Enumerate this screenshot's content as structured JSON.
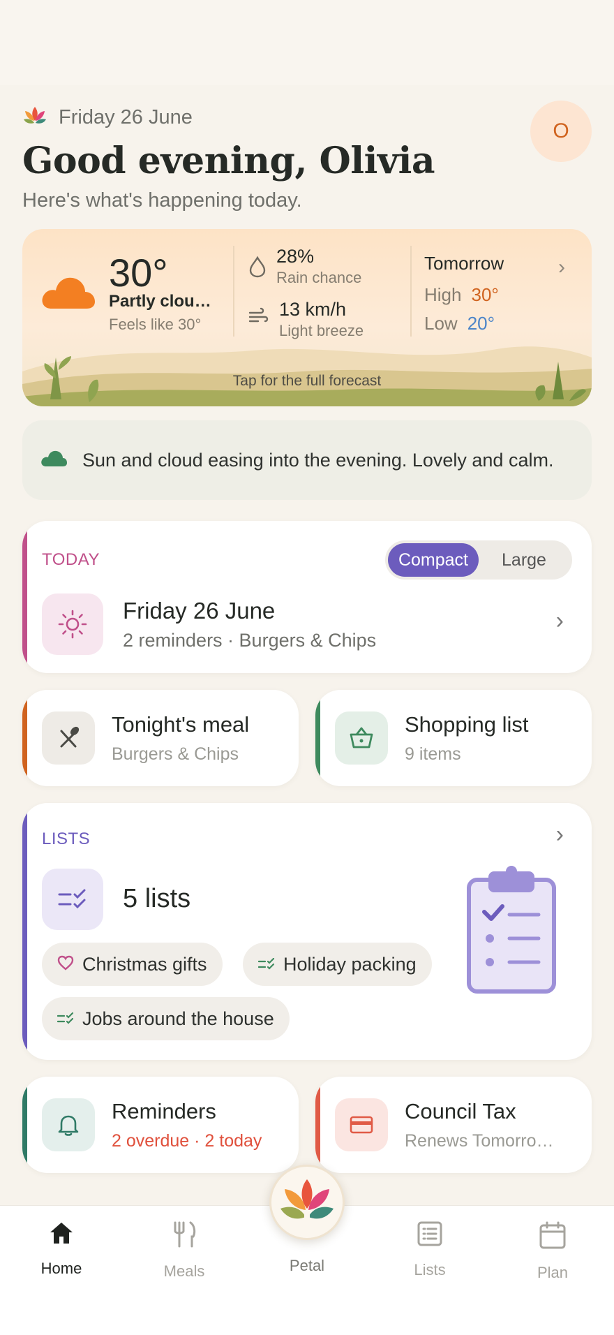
{
  "header": {
    "date": "Friday 26 June",
    "greeting": "Good evening, Olivia",
    "subtitle": "Here's what's happening today.",
    "avatar_initial": "O"
  },
  "weather": {
    "temp": "30°",
    "condition": "Partly clou…",
    "feels_like": "Feels like 30°",
    "rain_value": "28%",
    "rain_label": "Rain chance",
    "wind_value": "13 km/h",
    "wind_label": "Light breeze",
    "tomorrow_title": "Tomorrow",
    "high_label": "High",
    "high_value": "30°",
    "low_label": "Low",
    "low_value": "20°",
    "tap_hint": "Tap for the full forecast"
  },
  "note": {
    "text": "Sun and cloud easing into the evening. Lovely and calm."
  },
  "today": {
    "eyebrow": "TODAY",
    "view_compact": "Compact",
    "view_large": "Large",
    "title": "Friday 26 June",
    "subtitle": "2 reminders  ·  Burgers & Chips"
  },
  "meal": {
    "title": "Tonight's meal",
    "subtitle": "Burgers & Chips"
  },
  "shopping": {
    "title": "Shopping list",
    "subtitle": "9 items"
  },
  "lists": {
    "eyebrow": "LISTS",
    "count": "5 lists",
    "chips": [
      "Christmas gifts",
      "Holiday packing",
      "Jobs around the house"
    ]
  },
  "reminders": {
    "title": "Reminders",
    "subtitle": "2 overdue · 2 today"
  },
  "council": {
    "title": "Council Tax",
    "subtitle": "Renews Tomorro…"
  },
  "nav": {
    "home": "Home",
    "meals": "Meals",
    "petal": "Petal",
    "lists": "Lists",
    "plan": "Plan"
  },
  "colors": {
    "accent_purple": "#6c5cbd",
    "today_pink": "#c0508a",
    "meal_orange": "#d0631f",
    "shopping_green": "#3e8a5e",
    "reminders_teal": "#2f7a66",
    "council_red": "#e05a46"
  }
}
